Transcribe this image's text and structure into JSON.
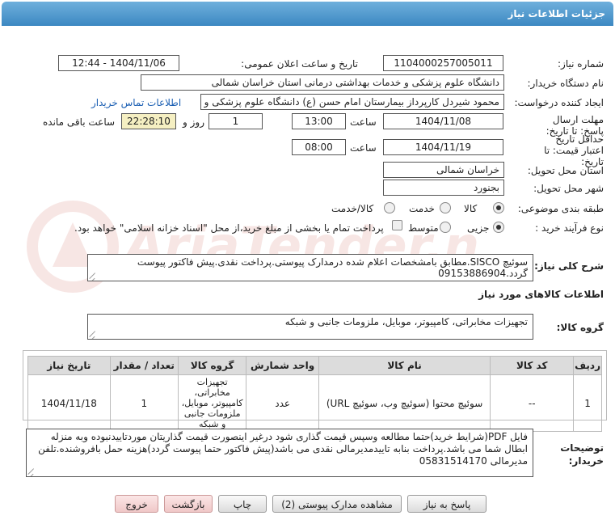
{
  "header": {
    "title": "جزئیات اطلاعات نیاز"
  },
  "fields": {
    "need_number_label": "شماره نیاز:",
    "need_number": "1104000257005011",
    "announce_label": "تاریخ و ساعت اعلان عمومی:",
    "announce_value": "1404/11/06 - 12:44",
    "buyer_org_label": "نام دستگاه خریدار:",
    "buyer_org": "دانشگاه علوم پزشکی و خدمات بهداشتی درمانی استان خراسان شمالی",
    "requester_label": "ایجاد کننده درخواست:",
    "requester": "محمود شیردل کارپرداز بیمارستان امام حسن (ع) دانشگاه علوم پزشکی و خدمات",
    "contact_link": "اطلاعات تماس خریدار",
    "reply_deadline_label": "مهلت ارسال پاسخ: تا تاریخ:",
    "reply_date": "1404/11/08",
    "time_label": "ساعت",
    "reply_time": "13:00",
    "days_value": "1",
    "days_label": "روز و",
    "remaining_time": "22:28:10",
    "remaining_label": "ساعت باقی مانده",
    "price_validity_label": "حداقل تاریخ اعتبار قیمت: تا تاریخ:",
    "validity_date": "1404/11/19",
    "validity_time": "08:00",
    "province_label": "استان محل تحویل:",
    "province": "خراسان شمالی",
    "city_label": "شهر محل تحویل:",
    "city": "بجنورد",
    "category_label": "طبقه بندی موضوعی:",
    "cat_goods": "کالا",
    "cat_service": "خدمت",
    "cat_goods_service": "کالا/خدمت",
    "process_label": "نوع فرآیند خرید :",
    "proc_partial": "جزیی",
    "proc_medium": "متوسط",
    "proc_note": "پرداخت تمام یا بخشی از مبلغ خرید،از محل \"اسناد خزانه اسلامی\" خواهد بود.",
    "description_label": "شرح کلی نیاز:",
    "description": "سوئیچ SISCO.مطابق بامشخصات اعلام شده درمدارک پیوستی.پرداخت نقدی.پیش فاکتور پیوست گردد.09153886904",
    "goods_info_title": "اطلاعات کالاهای مورد نیاز",
    "goods_group_label": "گروه کالا:",
    "goods_group": "تجهیزات مخابراتی، کامپیوتر، موبایل، ملزومات جانبی و شبکه",
    "buyer_notes_label": "توضیحات خریدار:",
    "buyer_notes": "فایل PDF(شرایط خرید)حتما مطالعه وسپس قیمت گذاری شود درغیر اینصورت قیمت گذاریتان موردتاییدنبوده وبه منزله ابطال شما می باشد.پرداخت بنابه تاییدمدیرمالی نقدی می باشد(پیش فاکتور حتما پیوست گردد)هزینه حمل بافروشنده.تلفن مدیرمالی 05831514170"
  },
  "table": {
    "headers": [
      "ردیف",
      "کد کالا",
      "نام کالا",
      "واحد شمارش",
      "گروه کالا",
      "تعداد / مقدار",
      "تاریخ نیاز"
    ],
    "rows": [
      [
        "1",
        "--",
        "سوئیچ محتوا (سوئیچ وب، سوئیچ URL)",
        "عدد",
        "تجهیزات مخابراتی، کامپیوتر، موبایل، ملزومات جانبی و شبکه",
        "1",
        "1404/11/18"
      ]
    ]
  },
  "buttons": {
    "reply": "پاسخ به نیاز",
    "attachments": "مشاهده مدارک پیوستی (2)",
    "print": "چاپ",
    "back": "بازگشت",
    "exit": "خروج"
  },
  "watermark": {
    "text": "AriaTender.net"
  },
  "colors": {
    "header": "#3c88c2",
    "link": "#1b5fb3",
    "remaining_bg": "#f5efc2",
    "watermark": "#c0392b"
  }
}
